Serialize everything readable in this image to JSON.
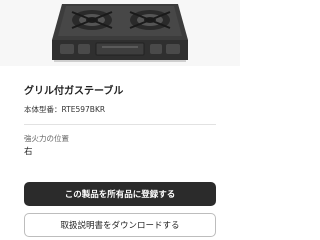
{
  "product": {
    "image_alt": "grill-gas-stove-photo",
    "name": "グリル付ガステーブル",
    "model_label": "本体型番：",
    "model_number": "RTE597BKR"
  },
  "spec": {
    "strong_burner_label": "強火力の位置",
    "strong_burner_value": "右"
  },
  "actions": {
    "register_label": "この製品を所有品に登録する",
    "download_manual_label": "取扱説明書をダウンロードする"
  },
  "colors": {
    "primary_button": "#2b2b2b",
    "stove_body": "#3a3a3a"
  }
}
